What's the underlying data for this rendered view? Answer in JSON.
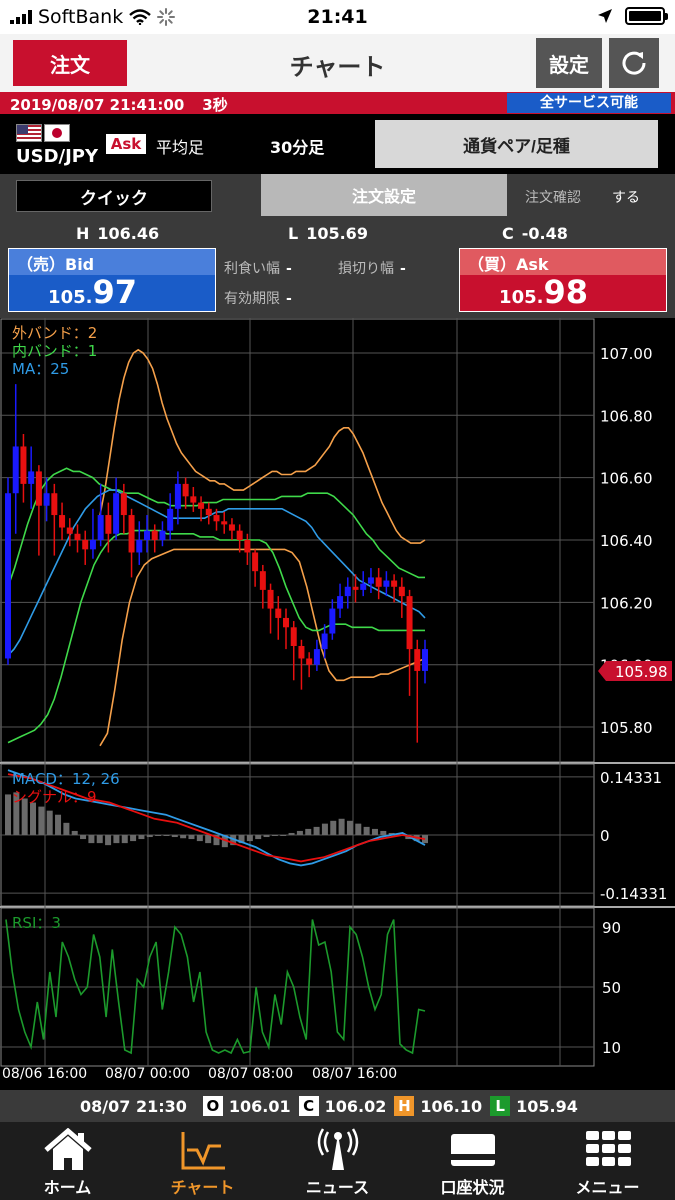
{
  "status_bar": {
    "carrier": "SoftBank",
    "time": "21:41"
  },
  "header": {
    "order_label": "注文",
    "title": "チャート",
    "settings_label": "設定"
  },
  "time_bar": {
    "datetime": "2019/08/07 21:41:00",
    "interval": "3秒",
    "service_status": "全サービス可能"
  },
  "pair": {
    "name": "USD/JPY",
    "side": "Ask",
    "candle_type": "平均足",
    "timeframe": "30分足",
    "selector_label": "通貨ペア/足種"
  },
  "order_panel": {
    "quick_label": "クイック",
    "order_setting_label": "注文設定",
    "confirm_label": "注文確認",
    "confirm_value": "する",
    "high_label": "H",
    "high": "106.46",
    "low_label": "L",
    "low": "105.69",
    "change_label": "C",
    "change": "-0.48",
    "bid": {
      "label": "（売）Bid",
      "price_small": "105.",
      "price_big": "97"
    },
    "ask": {
      "label": "（買）Ask",
      "price_small": "105.",
      "price_big": "98"
    },
    "take_profit_label": "利食い幅",
    "take_profit_value": "-",
    "stop_loss_label": "損切り幅",
    "stop_loss_value": "-",
    "expiry_label": "有効期限",
    "expiry_value": "-"
  },
  "chart_data": [
    {
      "type": "candlestick",
      "legend": [
        {
          "text": "外バンド：2",
          "color": "#f5a04a"
        },
        {
          "text": "内バンド：1",
          "color": "#3fd94a"
        },
        {
          "text": "MA：25",
          "color": "#2f9be6"
        }
      ],
      "y_ticks": [
        "107.00",
        "106.80",
        "106.60",
        "106.40",
        "106.20",
        "106.00",
        "105.80"
      ],
      "ylim": [
        105.72,
        107.08
      ],
      "current_price": "105.98",
      "x_ticks": [
        "08/06 16:00",
        "08/07 00:00",
        "08/07 08:00",
        "08/07 16:00"
      ],
      "colors": {
        "up": "#1a1aff",
        "down": "#e81010",
        "outer_band": "#f5a04a",
        "inner_band": "#3fd94a",
        "ma": "#2f9be6"
      },
      "ma": [
        106.03,
        106.05,
        106.08,
        106.12,
        106.16,
        106.2,
        106.24,
        106.28,
        106.32,
        106.36,
        106.4,
        106.44,
        106.47,
        106.5,
        106.52,
        106.54,
        106.55,
        106.56,
        106.56,
        106.55,
        106.54,
        106.53,
        106.52,
        106.51,
        106.5,
        106.49,
        106.48,
        106.47,
        106.47,
        106.47,
        106.47,
        106.47,
        106.47,
        106.47,
        106.48,
        106.49,
        106.49,
        106.5,
        106.5,
        106.5,
        106.5,
        106.5,
        106.5,
        106.5,
        106.5,
        106.5,
        106.5,
        106.49,
        106.48,
        106.47,
        106.46,
        106.44,
        106.41,
        106.39,
        106.37,
        106.35,
        106.33,
        106.31,
        106.29,
        106.27,
        106.26,
        106.25,
        106.24,
        106.23,
        106.22,
        106.21,
        106.2,
        106.19,
        106.18,
        106.17,
        106.15
      ],
      "upper_outer": [
        106.48,
        106.56,
        106.66,
        106.76,
        106.85,
        106.92,
        106.97,
        107.0,
        107.01,
        107.0,
        106.98,
        106.95,
        106.9,
        106.84,
        106.79,
        106.75,
        106.71,
        106.68,
        106.66,
        106.64,
        106.62,
        106.61,
        106.6,
        106.59,
        106.59,
        106.58,
        106.58,
        106.57,
        106.56,
        106.56,
        106.56,
        106.57,
        106.58,
        106.59,
        106.6,
        106.61,
        106.62,
        106.62,
        106.61,
        106.61,
        106.61,
        106.62,
        106.62,
        106.62,
        106.63,
        106.64,
        106.66,
        106.68,
        106.7,
        106.73,
        106.75,
        106.76,
        106.76,
        106.74,
        106.71,
        106.68,
        106.64,
        106.6,
        106.56,
        106.52,
        106.49,
        106.46,
        106.43,
        106.41,
        106.4,
        106.39,
        106.39,
        106.39,
        106.4
      ],
      "upper_inner": [
        106.25,
        106.31,
        106.38,
        106.45,
        106.51,
        106.56,
        106.59,
        106.61,
        106.62,
        106.63,
        106.62,
        106.62,
        106.61,
        106.6,
        106.58,
        106.57,
        106.56,
        106.56,
        106.55,
        106.55,
        106.55,
        106.54,
        106.53,
        106.52,
        106.52,
        106.51,
        106.51,
        106.51,
        106.51,
        106.51,
        106.52,
        106.52,
        106.52,
        106.53,
        106.53,
        106.53,
        106.53,
        106.53,
        106.53,
        106.53,
        106.53,
        106.53,
        106.54,
        106.54,
        106.54,
        106.54,
        106.55,
        106.55,
        106.55,
        106.55,
        106.54,
        106.52,
        106.5,
        106.48,
        106.45,
        106.42,
        106.4,
        106.37,
        106.35,
        106.33,
        106.31,
        106.3,
        106.29,
        106.28,
        106.28
      ],
      "lower_inner": [
        105.75,
        105.76,
        105.77,
        105.78,
        105.79,
        105.81,
        105.84,
        105.89,
        105.96,
        106.04,
        106.12,
        106.2,
        106.26,
        106.32,
        106.36,
        106.39,
        106.41,
        106.42,
        106.42,
        106.43,
        106.43,
        106.43,
        106.43,
        106.43,
        106.42,
        106.42,
        106.42,
        106.42,
        106.42,
        106.41,
        106.41,
        106.41,
        106.4,
        106.4,
        106.4,
        106.4,
        106.4,
        106.4,
        106.4,
        106.39,
        106.36,
        106.31,
        106.25,
        106.2,
        106.15,
        106.12,
        106.11,
        106.11,
        106.12,
        106.13,
        106.13,
        106.13,
        106.12,
        106.12,
        106.12,
        106.12,
        106.11,
        106.11,
        106.11,
        106.11,
        106.11,
        106.11,
        106.11,
        106.11
      ],
      "lower_outer": [
        105.74,
        105.78,
        105.92,
        106.08,
        106.2,
        106.28,
        106.32,
        106.34,
        106.35,
        106.36,
        106.37,
        106.37,
        106.37,
        106.37,
        106.37,
        106.37,
        106.37,
        106.37,
        106.37,
        106.37,
        106.37,
        106.37,
        106.37,
        106.37,
        106.37,
        106.37,
        106.36,
        106.33,
        106.25,
        106.15,
        106.05,
        105.98,
        105.95,
        105.95,
        105.96,
        105.96,
        105.96,
        105.96,
        105.97,
        105.97,
        105.98,
        105.99,
        106.0,
        106.01,
        106.02
      ],
      "candles": [
        [
          106.02,
          106.55,
          106.6,
          106.0
        ],
        [
          106.55,
          106.7,
          106.9,
          106.42
        ],
        [
          106.7,
          106.58,
          106.74,
          106.52
        ],
        [
          106.58,
          106.62,
          106.7,
          106.5
        ],
        [
          106.62,
          106.51,
          106.64,
          106.35
        ],
        [
          106.51,
          106.55,
          106.6,
          106.46
        ],
        [
          106.55,
          106.48,
          106.58,
          106.35
        ],
        [
          106.48,
          106.44,
          106.52,
          106.4
        ],
        [
          106.44,
          106.42,
          106.47,
          106.38
        ],
        [
          106.42,
          106.4,
          106.45,
          106.36
        ],
        [
          106.4,
          106.37,
          106.43,
          106.32
        ],
        [
          106.37,
          106.4,
          106.5,
          106.34
        ],
        [
          106.4,
          106.48,
          106.58,
          106.38
        ],
        [
          106.48,
          106.42,
          106.52,
          106.36
        ],
        [
          106.42,
          106.55,
          106.6,
          106.4
        ],
        [
          106.55,
          106.48,
          106.58,
          106.42
        ],
        [
          106.48,
          106.36,
          106.5,
          106.28
        ],
        [
          106.36,
          106.4,
          106.46,
          106.32
        ],
        [
          106.4,
          106.43,
          106.48,
          106.36
        ],
        [
          106.43,
          106.4,
          106.45,
          106.36
        ],
        [
          106.4,
          106.43,
          106.46,
          106.38
        ],
        [
          106.43,
          106.5,
          106.55,
          106.4
        ],
        [
          106.5,
          106.58,
          106.62,
          106.45
        ],
        [
          106.58,
          106.54,
          106.6,
          106.5
        ],
        [
          106.54,
          106.52,
          106.57,
          106.49
        ],
        [
          106.52,
          106.5,
          106.54,
          106.46
        ],
        [
          106.5,
          106.48,
          106.52,
          106.45
        ],
        [
          106.48,
          106.46,
          106.5,
          106.43
        ],
        [
          106.46,
          106.45,
          106.49,
          106.42
        ],
        [
          106.45,
          106.43,
          106.47,
          106.4
        ],
        [
          106.43,
          106.4,
          106.45,
          106.36
        ],
        [
          106.4,
          106.36,
          106.42,
          106.32
        ],
        [
          106.36,
          106.3,
          106.37,
          106.25
        ],
        [
          106.3,
          106.24,
          106.32,
          106.18
        ],
        [
          106.24,
          106.18,
          106.26,
          106.1
        ],
        [
          106.18,
          106.15,
          106.22,
          106.08
        ],
        [
          106.15,
          106.12,
          106.18,
          106.05
        ],
        [
          106.12,
          106.06,
          106.14,
          105.95
        ],
        [
          106.06,
          106.02,
          106.08,
          105.92
        ],
        [
          106.02,
          106.0,
          106.04,
          105.96
        ],
        [
          106.0,
          106.05,
          106.08,
          105.98
        ],
        [
          106.05,
          106.1,
          106.13,
          106.02
        ],
        [
          106.1,
          106.18,
          106.21,
          106.08
        ],
        [
          106.18,
          106.22,
          106.26,
          106.15
        ],
        [
          106.22,
          106.25,
          106.28,
          106.18
        ],
        [
          106.25,
          106.24,
          106.29,
          106.2
        ],
        [
          106.24,
          106.26,
          106.3,
          106.22
        ],
        [
          106.26,
          106.28,
          106.31,
          106.23
        ],
        [
          106.28,
          106.25,
          106.31,
          106.21
        ],
        [
          106.25,
          106.27,
          106.3,
          106.22
        ],
        [
          106.27,
          106.25,
          106.29,
          106.2
        ],
        [
          106.25,
          106.22,
          106.28,
          106.15
        ],
        [
          106.22,
          106.05,
          106.24,
          105.9
        ],
        [
          106.05,
          105.98,
          106.08,
          105.75
        ],
        [
          105.98,
          106.05,
          106.08,
          105.94
        ]
      ]
    },
    {
      "type": "macd",
      "legend": [
        {
          "text": "MACD：12, 26",
          "color": "#2f9be6"
        },
        {
          "text": "シグナル：9",
          "color": "#e81010"
        }
      ],
      "y_ticks": [
        "0.14331",
        "0",
        "-0.14331"
      ],
      "ylim": [
        -0.175,
        0.175
      ],
      "macd": [
        0.16,
        0.15,
        0.14,
        0.13,
        0.115,
        0.1,
        0.09,
        0.085,
        0.08,
        0.075,
        0.07,
        0.065,
        0.06,
        0.055,
        0.05,
        0.04,
        0.03,
        0.02,
        0.01,
        0.0,
        -0.01,
        -0.02,
        -0.03,
        -0.045,
        -0.06,
        -0.07,
        -0.075,
        -0.07,
        -0.06,
        -0.05,
        -0.04,
        -0.025,
        -0.015,
        -0.005,
        0.0,
        0.005,
        -0.01,
        -0.025
      ],
      "signal": [
        0.15,
        0.145,
        0.14,
        0.13,
        0.12,
        0.11,
        0.1,
        0.09,
        0.085,
        0.08,
        0.07,
        0.06,
        0.05,
        0.04,
        0.035,
        0.03,
        0.02,
        0.01,
        0.0,
        -0.01,
        -0.02,
        -0.03,
        -0.04,
        -0.05,
        -0.055,
        -0.06,
        -0.065,
        -0.06,
        -0.055,
        -0.045,
        -0.035,
        -0.025,
        -0.015,
        -0.01,
        -0.005,
        0.0,
        -0.005,
        -0.01
      ],
      "histogram": [
        0.1,
        0.105,
        0.09,
        0.08,
        0.07,
        0.06,
        0.05,
        0.03,
        0.01,
        -0.01,
        -0.02,
        -0.02,
        -0.025,
        -0.02,
        -0.02,
        -0.015,
        -0.01,
        -0.005,
        0.0,
        0.0,
        -0.005,
        -0.008,
        -0.01,
        -0.015,
        -0.02,
        -0.025,
        -0.03,
        -0.025,
        -0.02,
        -0.015,
        -0.01,
        -0.005,
        0.0,
        0.0,
        0.005,
        0.01,
        0.015,
        0.02,
        0.028,
        0.035,
        0.04,
        0.035,
        0.028,
        0.02,
        0.015,
        0.01,
        0.005,
        0.0,
        -0.01,
        -0.015,
        -0.02
      ]
    },
    {
      "type": "rsi",
      "legend": [
        {
          "text": "RSI：3",
          "color": "#1c9a2c"
        }
      ],
      "y_ticks": [
        "90",
        "50",
        "10"
      ],
      "ylim": [
        0,
        100
      ],
      "values": [
        95,
        60,
        35,
        20,
        10,
        40,
        15,
        60,
        30,
        80,
        70,
        55,
        45,
        50,
        85,
        70,
        30,
        75,
        40,
        8,
        6,
        55,
        50,
        70,
        80,
        35,
        60,
        90,
        85,
        70,
        40,
        60,
        20,
        8,
        6,
        8,
        6,
        15,
        6,
        7,
        50,
        20,
        10,
        45,
        25,
        60,
        50,
        30,
        15,
        95,
        78,
        80,
        60,
        20,
        15,
        90,
        85,
        70,
        50,
        35,
        45,
        85,
        95,
        12,
        8,
        6,
        35,
        34
      ]
    }
  ],
  "ohlc_bar": {
    "time": "08/07 21:30",
    "o_label": "O",
    "open": "106.01",
    "c_label": "C",
    "close": "106.02",
    "h_label": "H",
    "high": "106.10",
    "l_label": "L",
    "low": "105.94"
  },
  "tabs": [
    {
      "label": "ホーム",
      "icon": "home-icon"
    },
    {
      "label": "チャート",
      "icon": "chart-icon",
      "active": true
    },
    {
      "label": "ニュース",
      "icon": "news-icon"
    },
    {
      "label": "口座状況",
      "icon": "account-icon"
    },
    {
      "label": "メニュー",
      "icon": "menu-icon"
    }
  ]
}
